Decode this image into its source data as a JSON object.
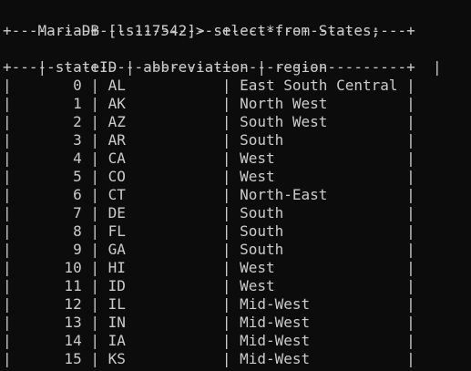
{
  "terminal": {
    "prompt": "MariaDB [ls117542]> ",
    "command": "select*from States;"
  },
  "table": {
    "border_line": "+---------+--------------+--------------------+",
    "columns": [
      "stateID",
      "abbreviation",
      "region"
    ],
    "rows": [
      [
        "0",
        "AL",
        "East South Central"
      ],
      [
        "1",
        "AK",
        "North West"
      ],
      [
        "2",
        "AZ",
        "South West"
      ],
      [
        "3",
        "AR",
        "South"
      ],
      [
        "4",
        "CA",
        "West"
      ],
      [
        "5",
        "CO",
        "West"
      ],
      [
        "6",
        "CT",
        "North-East"
      ],
      [
        "7",
        "DE",
        "South"
      ],
      [
        "8",
        "FL",
        "South"
      ],
      [
        "9",
        "GA",
        "South"
      ],
      [
        "10",
        "HI",
        "West"
      ],
      [
        "11",
        "ID",
        "West"
      ],
      [
        "12",
        "IL",
        "Mid-West"
      ],
      [
        "13",
        "IN",
        "Mid-West"
      ],
      [
        "14",
        "IA",
        "Mid-West"
      ],
      [
        "15",
        "KS",
        "Mid-West"
      ]
    ]
  },
  "colors": {
    "background": "#0c0c0c",
    "foreground": "#cccccc"
  }
}
